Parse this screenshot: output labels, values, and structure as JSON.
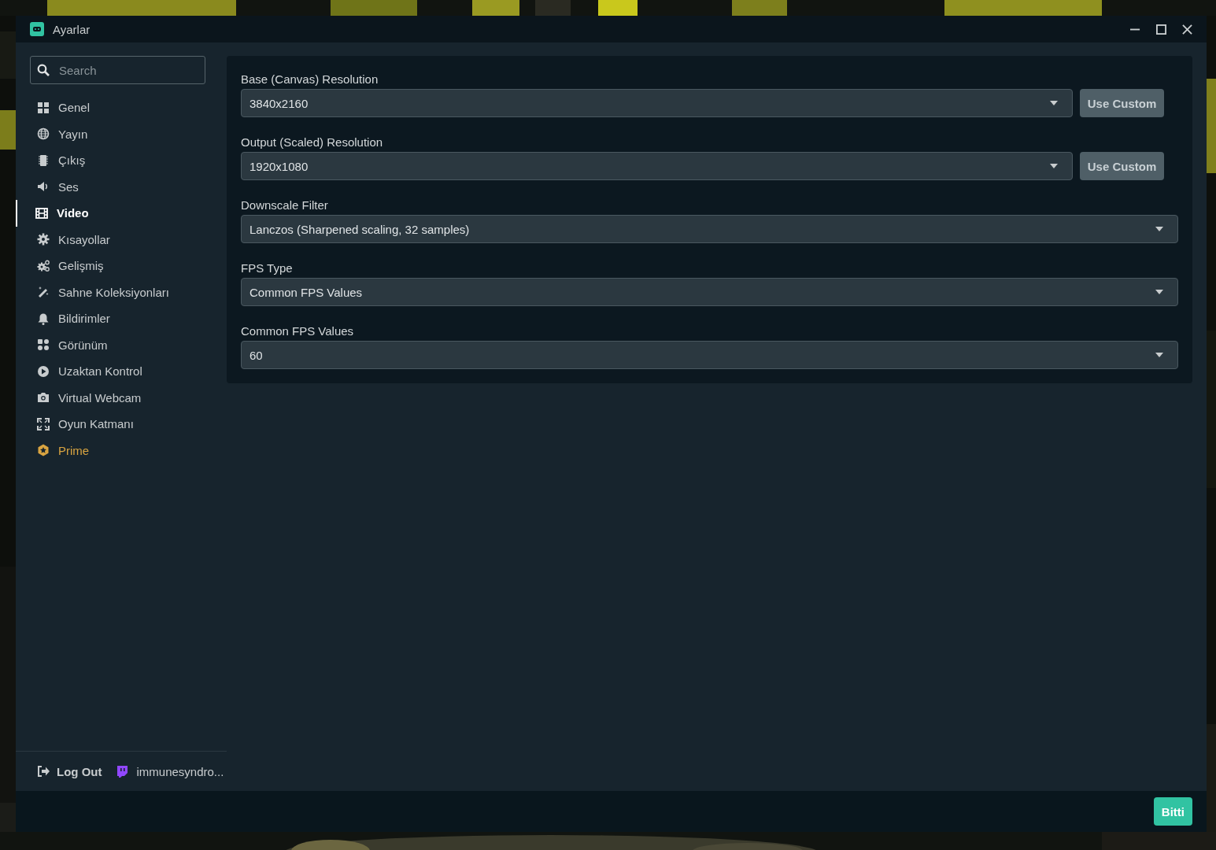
{
  "window": {
    "title": "Ayarlar"
  },
  "sidebar": {
    "search": {
      "placeholder": "Search"
    },
    "items": [
      {
        "label": "Genel",
        "selected": false,
        "kind": "normal"
      },
      {
        "label": "Yayın",
        "selected": false,
        "kind": "normal"
      },
      {
        "label": "Çıkış",
        "selected": false,
        "kind": "normal"
      },
      {
        "label": "Ses",
        "selected": false,
        "kind": "normal"
      },
      {
        "label": "Video",
        "selected": true,
        "kind": "normal"
      },
      {
        "label": "Kısayollar",
        "selected": false,
        "kind": "normal"
      },
      {
        "label": "Gelişmiş",
        "selected": false,
        "kind": "normal"
      },
      {
        "label": "Sahne Koleksiyonları",
        "selected": false,
        "kind": "normal"
      },
      {
        "label": "Bildirimler",
        "selected": false,
        "kind": "normal"
      },
      {
        "label": "Görünüm",
        "selected": false,
        "kind": "normal"
      },
      {
        "label": "Uzaktan Kontrol",
        "selected": false,
        "kind": "normal"
      },
      {
        "label": "Virtual Webcam",
        "selected": false,
        "kind": "normal"
      },
      {
        "label": "Oyun Katmanı",
        "selected": false,
        "kind": "normal"
      },
      {
        "label": "Prime",
        "selected": false,
        "kind": "prime"
      }
    ],
    "logout": "Log Out",
    "account": "immunesyndro..."
  },
  "settings": [
    {
      "label": "Base (Canvas) Resolution",
      "value": "3840x2160",
      "button": "Use Custom"
    },
    {
      "label": "Output (Scaled) Resolution",
      "value": "1920x1080",
      "button": "Use Custom"
    },
    {
      "label": "Downscale Filter",
      "value": "Lanczos (Sharpened scaling, 32 samples)"
    },
    {
      "label": "FPS Type",
      "value": "Common FPS Values"
    },
    {
      "label": "Common FPS Values",
      "value": "60"
    }
  ],
  "done_button": "Bitti"
}
